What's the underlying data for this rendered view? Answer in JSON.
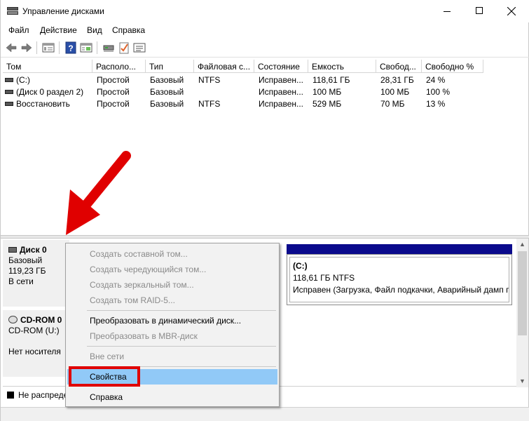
{
  "window": {
    "title": "Управление дисками"
  },
  "menu": [
    "Файл",
    "Действие",
    "Вид",
    "Справка"
  ],
  "toolbar": {
    "icons": [
      "back-arrow-icon",
      "forward-arrow-icon",
      "console-tree-icon",
      "help-icon",
      "properties-icon",
      "connect-icon",
      "check-icon",
      "list-icon"
    ]
  },
  "volumes": {
    "headers": [
      "Том",
      "Располо...",
      "Тип",
      "Файловая с...",
      "Состояние",
      "Емкость",
      "Свобод...",
      "Свободно %"
    ],
    "rows": [
      [
        "(C:)",
        "Простой",
        "Базовый",
        "NTFS",
        "Исправен...",
        "118,61 ГБ",
        "28,31 ГБ",
        "24 %"
      ],
      [
        "(Диск 0 раздел 2)",
        "Простой",
        "Базовый",
        "",
        "Исправен...",
        "100 МБ",
        "100 МБ",
        "100 %"
      ],
      [
        "Восстановить",
        "Простой",
        "Базовый",
        "NTFS",
        "Исправен...",
        "529 МБ",
        "70 МБ",
        "13 %"
      ]
    ]
  },
  "disks": [
    {
      "name": "Диск 0",
      "type": "Базовый",
      "size": "119,23 ГБ",
      "status": "В сети"
    },
    {
      "name": "CD-ROM 0",
      "type": "CD-ROM (U:)",
      "size": "",
      "status": "Нет носителя"
    }
  ],
  "partition_c": {
    "label": "(C:)",
    "size_fs": "118,61 ГБ NTFS",
    "status": "Исправен (Загрузка, Файл подкачки, Аварийный дамп п"
  },
  "legend": {
    "label": "Не распреде"
  },
  "context_menu": {
    "items": [
      {
        "label": "Создать составной том...",
        "disabled": true
      },
      {
        "label": "Создать чередующийся том...",
        "disabled": true
      },
      {
        "label": "Создать зеркальный том...",
        "disabled": true
      },
      {
        "label": "Создать том RAID-5...",
        "disabled": true
      },
      {
        "label": "Преобразовать в динамический диск...",
        "disabled": false
      },
      {
        "label": "Преобразовать в MBR-диск",
        "disabled": true
      },
      {
        "label": "Вне сети",
        "disabled": true
      },
      {
        "label": "Свойства",
        "disabled": false,
        "selected": true
      },
      {
        "label": "Справка",
        "disabled": false
      }
    ]
  },
  "colors": {
    "annotation_red": "#e00000",
    "menu_selected": "#91c9f7",
    "partition_header": "#0a0a8c"
  }
}
